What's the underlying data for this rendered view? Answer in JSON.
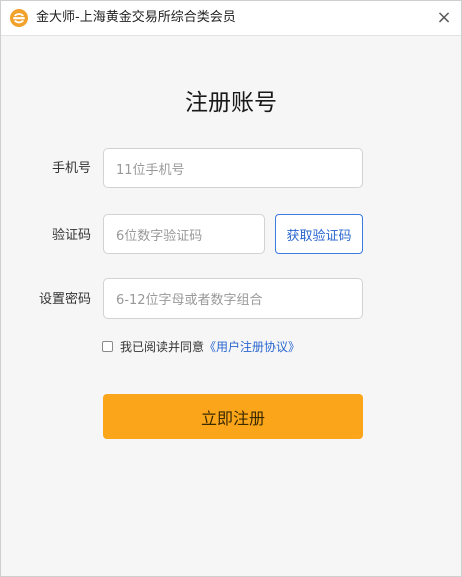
{
  "window": {
    "title": "金大师-上海黄金交易所综合类会员",
    "logo_icon": "gold-coin-logo-icon",
    "close_glyph": "×"
  },
  "form": {
    "heading": "注册账号",
    "phone": {
      "label": "手机号",
      "placeholder": "11位手机号",
      "value": ""
    },
    "code": {
      "label": "验证码",
      "placeholder": "6位数字验证码",
      "value": "",
      "button": "获取验证码"
    },
    "password": {
      "label": "设置密码",
      "placeholder": "6-12位字母或者数字组合",
      "value": ""
    },
    "agreement": {
      "checked": false,
      "text": "我已阅读并同意",
      "link": "《用户注册协议》"
    },
    "submit": "立即注册"
  },
  "colors": {
    "accent": "#fba51b",
    "link": "#2a67cf",
    "background": "#f6f6f7"
  }
}
